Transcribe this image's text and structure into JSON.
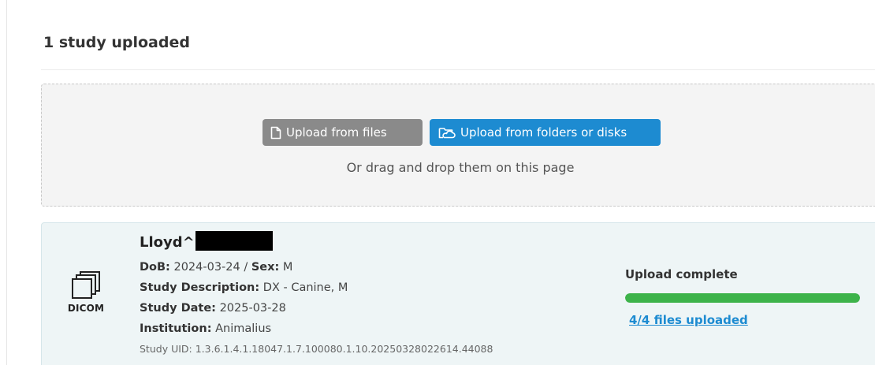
{
  "page": {
    "title": "1 study uploaded"
  },
  "dropzone": {
    "upload_files_label": "Upload from files",
    "upload_files_icon": "file-icon",
    "upload_folders_label": "Upload from folders or disks",
    "upload_folders_icon": "folder-cloud-icon",
    "hint": "Or drag and drop them on this page"
  },
  "study": {
    "icon": "dicom-stack-icon",
    "icon_label": "DICOM",
    "patient_name": "Lloyd^",
    "patient_name_redacted": true,
    "dob_label": "DoB:",
    "dob_value": "2024-03-24",
    "separator": "/",
    "sex_label": "Sex:",
    "sex_value": "M",
    "description_label": "Study Description:",
    "description_value": "DX - Canine, M",
    "date_label": "Study Date:",
    "date_value": "2025-03-28",
    "institution_label": "Institution:",
    "institution_value": "Animalius",
    "uid_label": "Study UID:",
    "uid_value": "1.3.6.1.4.1.18047.1.7.100080.1.10.20250328022614.44088",
    "status": "Upload complete",
    "progress_fraction": 1.0,
    "files_link": "4/4 files uploaded"
  },
  "colors": {
    "primary": "#1d8bd1",
    "secondary_button": "#8a8a8a",
    "progress": "#3db34a",
    "card_background": "#eef5f6"
  }
}
